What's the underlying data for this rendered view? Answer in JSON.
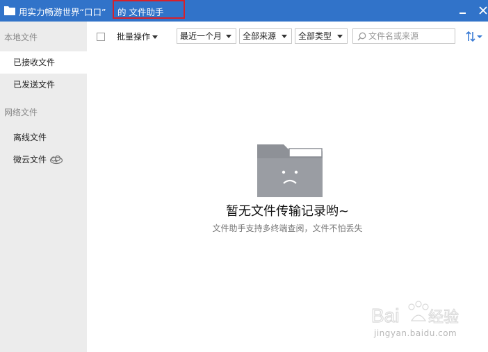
{
  "window": {
    "title_main": "用实力畅游世界“口口”",
    "title_suffix": "的 文件助手",
    "controls": [
      "minimize-icon",
      "close-icon"
    ],
    "accent_color": "#3173c9",
    "highlight_color": "#d7202a"
  },
  "sidebar": {
    "local_section": "本地文件",
    "local_items": [
      {
        "label": "已接收文件",
        "active": true
      },
      {
        "label": "已发送文件",
        "active": false
      }
    ],
    "network_section": "网络文件",
    "network_items": [
      {
        "label": "离线文件"
      },
      {
        "label": "微云文件",
        "icon": "cloud-icon"
      }
    ]
  },
  "toolbar": {
    "batch_label": "批量操作",
    "time_filter": "最近一个月",
    "source_filter": "全部来源",
    "type_filter": "全部类型",
    "search_placeholder": "文件名或来源",
    "sort_icon": "sort-icon"
  },
  "empty_state": {
    "icon": "sad-folder-icon",
    "title": "暂无文件传输记录哟~",
    "subtitle": "文件助手支持多终端查阅，文件不怕丢失"
  },
  "watermark": {
    "brand": "Baidu经验",
    "url": "jingyan.baidu.com"
  }
}
